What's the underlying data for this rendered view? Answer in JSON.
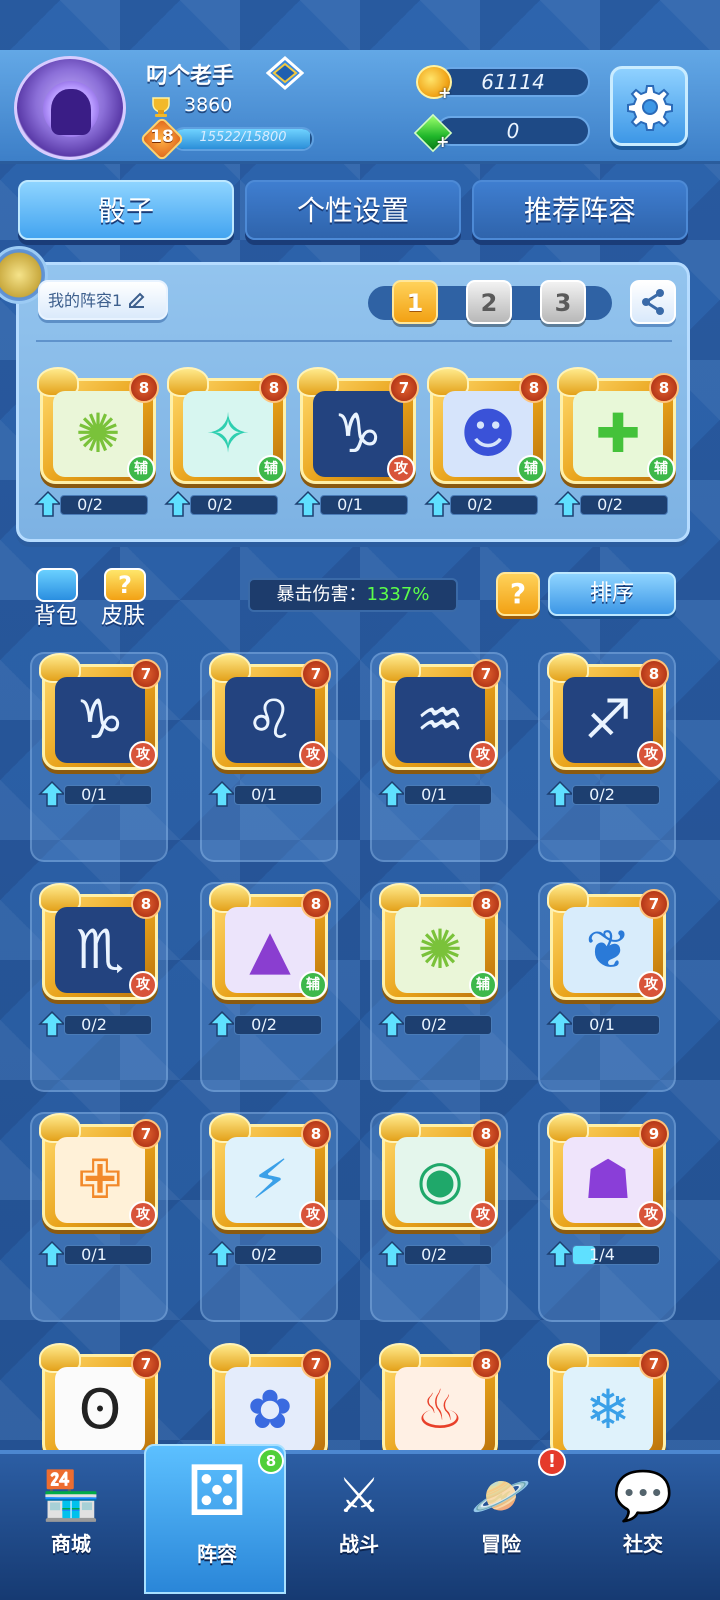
{
  "profile": {
    "username": "叼个老手",
    "trophies": "3860",
    "level": "18",
    "xp_text": "15522/15800",
    "xp_progress": 0.982,
    "coins": "61114",
    "gems": "0"
  },
  "tabs": [
    {
      "label": "骰子",
      "active": true
    },
    {
      "label": "个性设置",
      "active": false
    },
    {
      "label": "推荐阵容",
      "active": false
    }
  ],
  "deck": {
    "name": "我的阵容1",
    "slots": [
      "1",
      "2",
      "3"
    ],
    "selected_slot": "1",
    "cards": [
      {
        "icon": "dandelion-icon",
        "glyph": "✺",
        "level": "8",
        "role": "辅",
        "role_type": "sup",
        "bg": "#eaf6d8",
        "color": "#7ac23a",
        "progress": "0/2",
        "ratio": 0
      },
      {
        "icon": "swirl-icon",
        "glyph": "✧",
        "level": "8",
        "role": "辅",
        "role_type": "sup",
        "bg": "#d7f6f0",
        "color": "#2ecfb0",
        "progress": "0/2",
        "ratio": 0
      },
      {
        "icon": "capricorn-icon",
        "glyph": "♑",
        "level": "7",
        "role": "攻",
        "role_type": "atk",
        "bg": "#23437f",
        "color": "#eaf4ff",
        "progress": "0/1",
        "ratio": 0
      },
      {
        "icon": "mask-icon",
        "glyph": "☻",
        "level": "8",
        "role": "辅",
        "role_type": "sup",
        "bg": "#d6e4fb",
        "color": "#3a52d8",
        "progress": "0/2",
        "ratio": 0
      },
      {
        "icon": "plus-icon",
        "glyph": "✚",
        "level": "8",
        "role": "辅",
        "role_type": "sup",
        "bg": "#e8f8d8",
        "color": "#44c23a",
        "progress": "0/2",
        "ratio": 0
      }
    ]
  },
  "toolbar": {
    "bag": "背包",
    "skin": "皮肤",
    "skin_icon": "?",
    "crit_label": "暴击伤害：",
    "crit_value": "1337%",
    "help": "?",
    "sort": "排序"
  },
  "collection": [
    {
      "icon": "capricorn-icon",
      "glyph": "♑",
      "level": "7",
      "role": "攻",
      "role_type": "atk",
      "bg": "#23437f",
      "color": "#eaf4ff",
      "progress": "0/1",
      "ratio": 0
    },
    {
      "icon": "leo-icon",
      "glyph": "♌",
      "level": "7",
      "role": "攻",
      "role_type": "atk",
      "bg": "#23437f",
      "color": "#eaf4ff",
      "progress": "0/1",
      "ratio": 0
    },
    {
      "icon": "aquarius-icon",
      "glyph": "♒",
      "level": "7",
      "role": "攻",
      "role_type": "atk",
      "bg": "#23437f",
      "color": "#eaf4ff",
      "progress": "0/1",
      "ratio": 0
    },
    {
      "icon": "sagittarius-icon",
      "glyph": "♐",
      "level": "8",
      "role": "攻",
      "role_type": "atk",
      "bg": "#23437f",
      "color": "#eaf4ff",
      "progress": "0/2",
      "ratio": 0
    },
    {
      "icon": "scorpio-icon",
      "glyph": "♏",
      "level": "8",
      "role": "攻",
      "role_type": "atk",
      "bg": "#23437f",
      "color": "#eaf4ff",
      "progress": "0/2",
      "ratio": 0
    },
    {
      "icon": "witch-hat-icon",
      "glyph": "▲",
      "level": "8",
      "role": "辅",
      "role_type": "sup",
      "bg": "#ece4fb",
      "color": "#8a3ed0",
      "progress": "0/2",
      "ratio": 0
    },
    {
      "icon": "dandelion-icon",
      "glyph": "✺",
      "level": "8",
      "role": "辅",
      "role_type": "sup",
      "bg": "#eaf6d8",
      "color": "#7ac23a",
      "progress": "0/2",
      "ratio": 0
    },
    {
      "icon": "dragon-icon",
      "glyph": "❦",
      "level": "7",
      "role": "攻",
      "role_type": "atk",
      "bg": "#d8ecfb",
      "color": "#2a7ad8",
      "progress": "0/1",
      "ratio": 0
    },
    {
      "icon": "cross-icon",
      "glyph": "✙",
      "level": "7",
      "role": "攻",
      "role_type": "atk",
      "bg": "#fff1d8",
      "color": "#f2892a",
      "progress": "0/1",
      "ratio": 0
    },
    {
      "icon": "lightning-icon",
      "glyph": "⚡",
      "level": "8",
      "role": "攻",
      "role_type": "atk",
      "bg": "#dff2fb",
      "color": "#3aa0e8",
      "progress": "0/2",
      "ratio": 0
    },
    {
      "icon": "orb-icon",
      "glyph": "◉",
      "level": "8",
      "role": "攻",
      "role_type": "atk",
      "bg": "#e4f6ec",
      "color": "#1fa86a",
      "progress": "0/2",
      "ratio": 0
    },
    {
      "icon": "ghost-icon",
      "glyph": "☗",
      "level": "9",
      "role": "攻",
      "role_type": "atk",
      "bg": "#efe4fb",
      "color": "#8a3ed8",
      "progress": "1/4",
      "ratio": 0.25
    },
    {
      "icon": "panda-icon",
      "glyph": "ʘ",
      "level": "7",
      "role": "",
      "role_type": "",
      "bg": "#fbfbfb",
      "color": "#222222",
      "progress": "",
      "ratio": 0
    },
    {
      "icon": "flower-icon",
      "glyph": "✿",
      "level": "7",
      "role": "",
      "role_type": "",
      "bg": "#e4ecfb",
      "color": "#3a6ae0",
      "progress": "",
      "ratio": 0
    },
    {
      "icon": "fire-icon",
      "glyph": "♨",
      "level": "8",
      "role": "",
      "role_type": "",
      "bg": "#fff0e4",
      "color": "#e8402a",
      "progress": "",
      "ratio": 0
    },
    {
      "icon": "ice-icon",
      "glyph": "❄",
      "level": "7",
      "role": "",
      "role_type": "",
      "bg": "#dff2fb",
      "color": "#3aa0e8",
      "progress": "",
      "ratio": 0
    }
  ],
  "nav": [
    {
      "label": "商城",
      "icon": "shop-icon",
      "glyph": "🏪",
      "active": false
    },
    {
      "label": "阵容",
      "icon": "dice-icon",
      "glyph": "⚄",
      "active": true,
      "badge": "8"
    },
    {
      "label": "战斗",
      "icon": "crossed-swords-icon",
      "glyph": "⚔",
      "active": false
    },
    {
      "label": "冒险",
      "icon": "planet-icon",
      "glyph": "🪐",
      "active": false,
      "alert": "!"
    },
    {
      "label": "社交",
      "icon": "chat-icon",
      "glyph": "💬",
      "active": false
    }
  ],
  "colors": {
    "accent": "#43a4f0",
    "gold": "#f2a114",
    "crit_green": "#5cff4a"
  }
}
